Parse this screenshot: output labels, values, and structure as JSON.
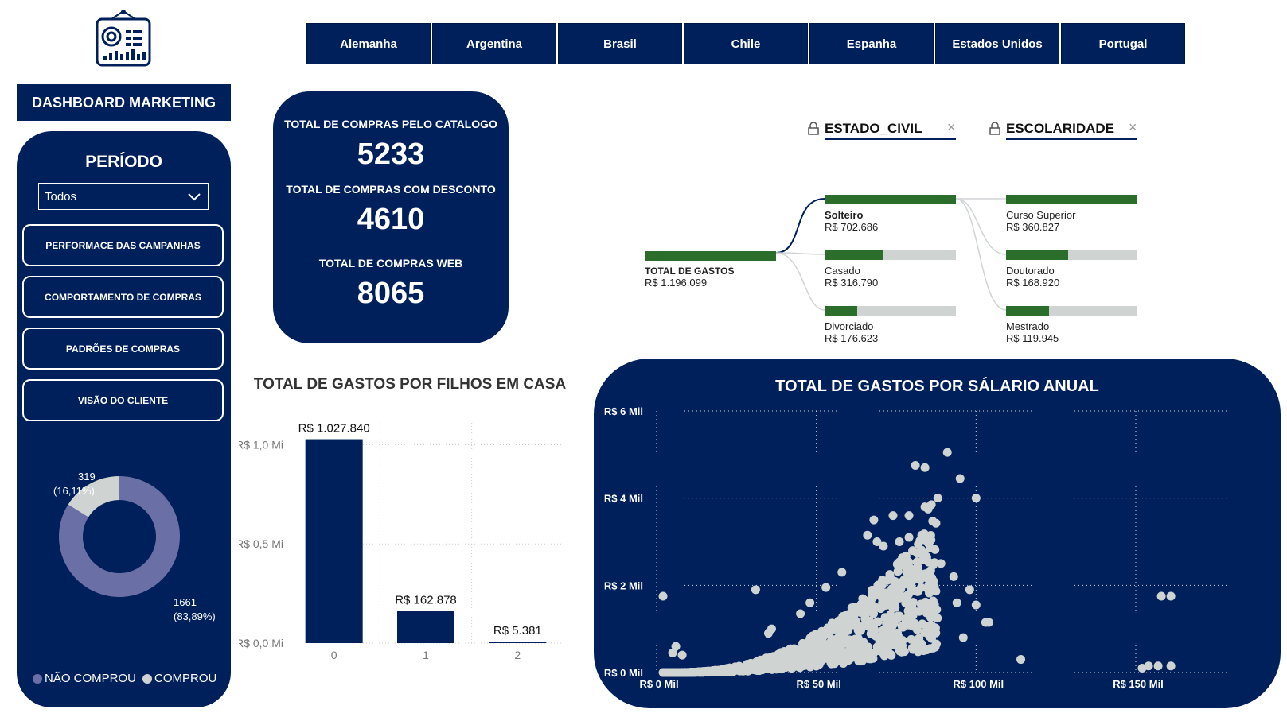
{
  "header": {
    "dashboard_title": "DASHBOARD MARKETING",
    "logo_icon": "dashboard-logo-icon"
  },
  "tabs": [
    {
      "label": "Alemanha"
    },
    {
      "label": "Argentina"
    },
    {
      "label": "Brasil"
    },
    {
      "label": "Chile"
    },
    {
      "label": "Espanha"
    },
    {
      "label": "Estados Unidos"
    },
    {
      "label": "Portugal"
    }
  ],
  "sidebar": {
    "periodo_label": "PERÍODO",
    "periodo_value": "Todos",
    "nav": [
      {
        "label": "PERFORMACE DAS CAMPANHAS"
      },
      {
        "label": "COMPORTAMENTO DE COMPRAS"
      },
      {
        "label": "PADRÕES DE COMPRAS"
      },
      {
        "label": "VISÃO DO CLIENTE"
      }
    ],
    "donut": {
      "slices": [
        {
          "name": "NÃO COMPROU",
          "value": 1661,
          "label_count": "1661",
          "label_pct": "(83,89%)",
          "color": "#6a70a6"
        },
        {
          "name": "COMPROU",
          "value": 319,
          "label_count": "319",
          "label_pct": "(16,11%)",
          "color": "#cfd4d2"
        }
      ]
    },
    "legend": [
      "NÃO COMPROU",
      "COMPROU"
    ]
  },
  "kpis": [
    {
      "label": "TOTAL DE COMPRAS PELO CATALOGO",
      "value": "5233"
    },
    {
      "label": "TOTAL DE COMPRAS COM DESCONTO",
      "value": "4610"
    },
    {
      "label": "TOTAL DE COMPRAS WEB",
      "value": "8065"
    }
  ],
  "tree": {
    "fields": [
      {
        "label": "ESTADO_CIVIL"
      },
      {
        "label": "ESCOLARIDADE"
      }
    ],
    "root": {
      "name": "TOTAL DE GASTOS",
      "value": "R$ 1.196.099",
      "fraction": 1.0
    },
    "level1": [
      {
        "name": "Solteiro",
        "value": "R$ 702.686",
        "fraction": 1.0
      },
      {
        "name": "Casado",
        "value": "R$ 316.790",
        "fraction": 0.45
      },
      {
        "name": "Divorciado",
        "value": "R$ 176.623",
        "fraction": 0.25
      }
    ],
    "level2": [
      {
        "name": "Curso Superior",
        "value": "R$ 360.827",
        "fraction": 1.0
      },
      {
        "name": "Doutorado",
        "value": "R$ 168.920",
        "fraction": 0.47
      },
      {
        "name": "Mestrado",
        "value": "R$ 119.945",
        "fraction": 0.33
      }
    ]
  },
  "chart_data": [
    {
      "type": "bar",
      "title": "TOTAL DE GASTOS POR FILHOS EM CASA",
      "categories": [
        "0",
        "1",
        "2"
      ],
      "values": [
        1027840,
        162878,
        5381
      ],
      "data_labels": [
        "R$ 1.027.840",
        "R$ 162.878",
        "R$ 5.381"
      ],
      "y_ticks": [
        "R$ 0,0 Mi",
        "R$ 0,5 Mi",
        "R$ 1,0 Mi"
      ],
      "y_tick_values": [
        0,
        500000,
        1000000
      ],
      "ylim": [
        0,
        1030000
      ],
      "color": "#00205b"
    },
    {
      "type": "scatter",
      "title": "TOTAL DE GASTOS POR SÁLARIO ANUAL",
      "x_ticks": [
        "R$ 0 Mil",
        "R$ 50 Mil",
        "R$ 100 Mil",
        "R$ 150 Mil"
      ],
      "x_tick_values": [
        0,
        50000,
        100000,
        150000
      ],
      "y_ticks": [
        "R$ 0 Mil",
        "R$ 2 Mil",
        "R$ 4 Mil",
        "R$ 6 Mil"
      ],
      "y_tick_values": [
        0,
        2000,
        4000,
        6000
      ],
      "xlim": [
        0,
        180000
      ],
      "ylim": [
        0,
        6000
      ],
      "point_color": "#cfd4d2",
      "grid": true,
      "notable_points": [
        [
          91000,
          5050
        ],
        [
          81000,
          4750
        ],
        [
          84000,
          4700
        ],
        [
          95000,
          4450
        ],
        [
          100000,
          4000
        ],
        [
          86000,
          3850
        ],
        [
          84000,
          3800
        ],
        [
          88000,
          4000
        ],
        [
          85000,
          3750
        ],
        [
          68000,
          3500
        ],
        [
          79000,
          3600
        ],
        [
          74000,
          3600
        ],
        [
          66000,
          3150
        ],
        [
          69000,
          3000
        ],
        [
          71000,
          2900
        ],
        [
          79000,
          3100
        ],
        [
          83000,
          3150
        ],
        [
          76000,
          3000
        ],
        [
          2000,
          1750
        ],
        [
          31000,
          1900
        ],
        [
          100000,
          1550
        ],
        [
          103000,
          1150
        ],
        [
          104000,
          1150
        ],
        [
          96000,
          800
        ],
        [
          114000,
          300
        ],
        [
          158000,
          1750
        ],
        [
          161000,
          1750
        ],
        [
          152000,
          100
        ],
        [
          154000,
          150
        ],
        [
          157000,
          150
        ],
        [
          161000,
          150
        ],
        [
          5000,
          450
        ],
        [
          6000,
          600
        ],
        [
          8000,
          400
        ],
        [
          36000,
          1000
        ],
        [
          35000,
          900
        ],
        [
          48000,
          1600
        ],
        [
          53000,
          1950
        ],
        [
          45000,
          1350
        ],
        [
          58000,
          2300
        ],
        [
          73000,
          2250
        ],
        [
          89000,
          2500
        ],
        [
          93000,
          2200
        ],
        [
          98000,
          1900
        ],
        [
          94000,
          1600
        ]
      ]
    }
  ]
}
